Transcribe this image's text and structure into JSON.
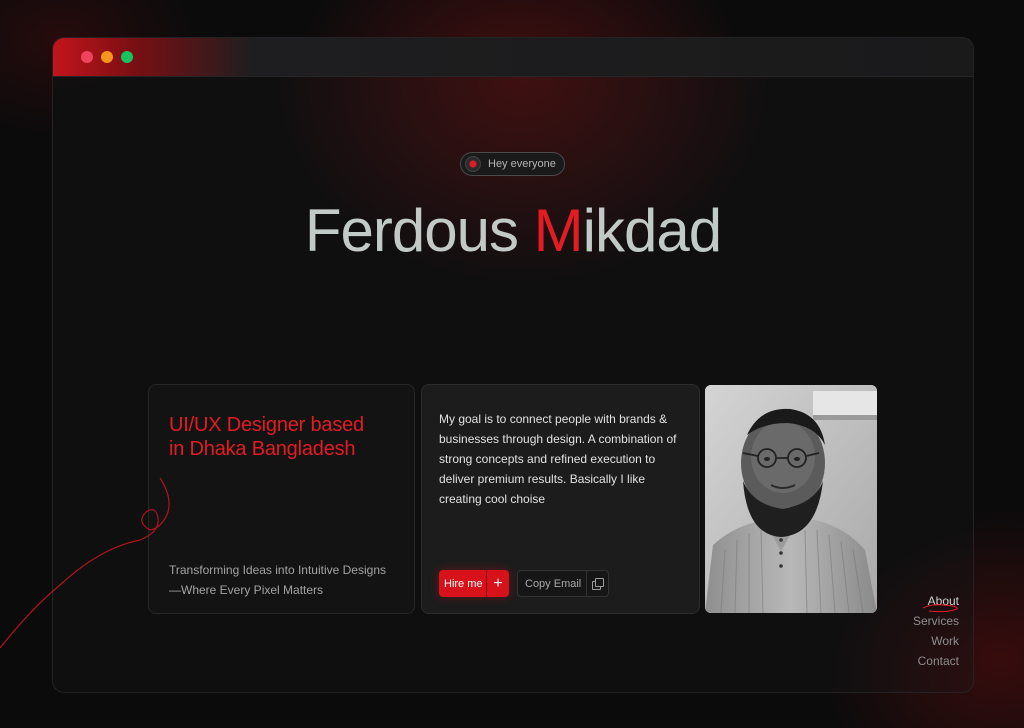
{
  "window": {
    "controls": [
      "close",
      "minimize",
      "maximize"
    ],
    "accent_color": "#e31b23"
  },
  "greeting": {
    "text": "Hey everyone",
    "icon": "record-icon"
  },
  "hero": {
    "first_name": "Ferdous",
    "last_initial": "M",
    "last_rest": "ikdad"
  },
  "intro_card": {
    "role": "UI/UX Designer based in Dhaka Bangladesh",
    "tagline": "Transforming Ideas into Intuitive Designs —Where Every Pixel Matters"
  },
  "bio_card": {
    "text": "My goal is to connect people with brands & businesses through design. A combination of strong concepts and refined execution to deliver premium results. Basically I like creating cool choise",
    "hire_label": "Hire me",
    "hire_icon": "plus-icon",
    "copy_label": "Copy Email",
    "copy_icon": "copy-icon"
  },
  "photo": {
    "alt": "portrait"
  },
  "nav": {
    "items": [
      "About",
      "Services",
      "Work",
      "Contact"
    ],
    "active": "About"
  }
}
